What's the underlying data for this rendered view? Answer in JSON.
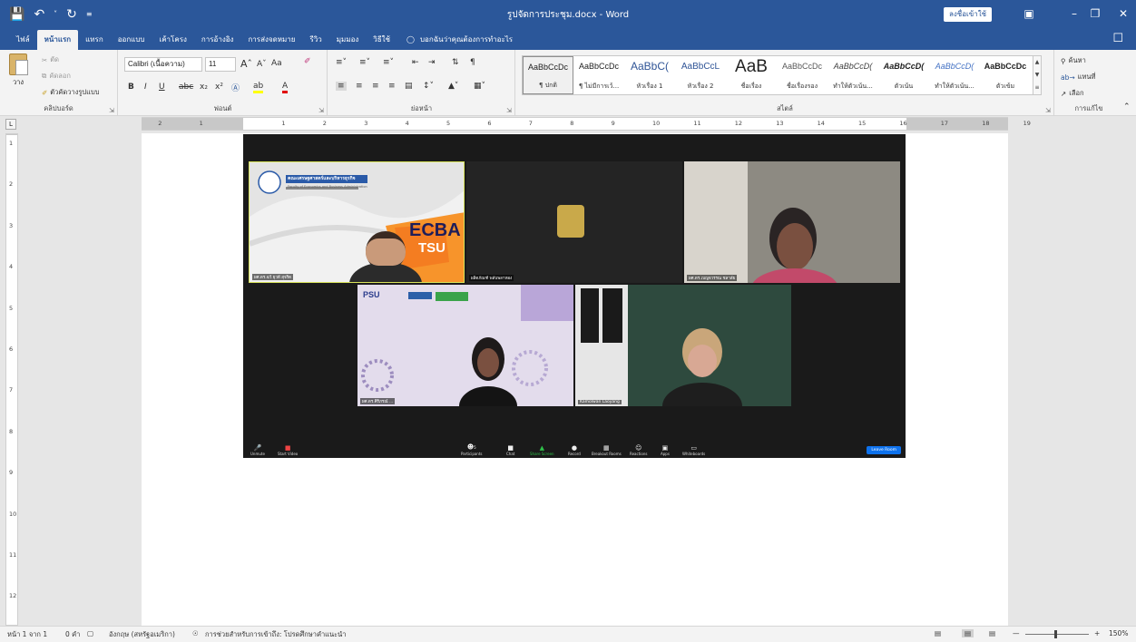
{
  "window": {
    "title": "รูปจัดการประชุม.docx - Word",
    "signin": "ลงชื่อเข้าใช้",
    "qat": {
      "save_icon": "save-icon",
      "undo_icon": "undo-icon",
      "redo_icon": "redo-icon"
    }
  },
  "tabs": [
    {
      "label": "ไฟล์"
    },
    {
      "label": "หน้าแรก"
    },
    {
      "label": "แทรก"
    },
    {
      "label": "ออกแบบ"
    },
    {
      "label": "เค้าโครง"
    },
    {
      "label": "การอ้างอิง"
    },
    {
      "label": "การส่งจดหมาย"
    },
    {
      "label": "รีวิว"
    },
    {
      "label": "มุมมอง"
    },
    {
      "label": "วิธีใช้"
    }
  ],
  "tellme": "บอกฉันว่าคุณต้องการทำอะไร",
  "ribbon": {
    "clipboard": {
      "group_label": "คลิปบอร์ด",
      "paste": "วาง",
      "cut": "ตัด",
      "copy": "คัดลอก",
      "format_painter": "ตัวคัดวางรูปแบบ"
    },
    "font": {
      "group_label": "ฟอนต์",
      "font_name": "Calibri (เนื้อความ)",
      "font_size": "11",
      "change_case": "Aa"
    },
    "paragraph": {
      "group_label": "ย่อหน้า"
    },
    "styles": {
      "group_label": "สไตล์",
      "items": [
        {
          "sample": "AaBbCcDc",
          "name": "¶ ปกติ"
        },
        {
          "sample": "AaBbCcDc",
          "name": "¶ ไม่มีการเว้..."
        },
        {
          "sample": "AaBbC(",
          "name": "หัวเรื่อง 1"
        },
        {
          "sample": "AaBbCcL",
          "name": "หัวเรื่อง 2"
        },
        {
          "sample": "AaB",
          "name": "ชื่อเรื่อง"
        },
        {
          "sample": "AaBbCcDc",
          "name": "ชื่อเรื่องรอง"
        },
        {
          "sample": "AaBbCcD(",
          "name": "ทำให้ตัวเน้น..."
        },
        {
          "sample": "AaBbCcD(",
          "name": "ตัวเน้น"
        },
        {
          "sample": "AaBbCcD(",
          "name": "ทำให้ตัวเน้น..."
        },
        {
          "sample": "AaBbCcDc",
          "name": "ตัวเข้ม"
        }
      ]
    },
    "editing": {
      "group_label": "การแก้ไข",
      "find": "ค้นหา",
      "replace": "แทนที่",
      "select": "เลือก"
    }
  },
  "ruler": {
    "corner": "L",
    "ticks": [
      "2",
      "1",
      "1",
      "2",
      "3",
      "4",
      "5",
      "6",
      "7",
      "8",
      "9",
      "10",
      "11",
      "12",
      "13",
      "14",
      "15",
      "16",
      "17",
      "18",
      "19"
    ],
    "vticks": [
      "1",
      "2",
      "3",
      "4",
      "5",
      "6",
      "7",
      "8",
      "9",
      "10",
      "11",
      "12",
      "13"
    ]
  },
  "zoom": {
    "participants": [
      {
        "name": "ผศ.ดร.ฉวี ยุวดี สุจริต"
      },
      {
        "name": "ผลิตภัณฑ์ พลับพลาทอง"
      },
      {
        "name": "ผศ.ดร.เบญจวรรณ ชลาสัย"
      },
      {
        "name": "ผศ.ดร.ศิริภรณ์ ..."
      },
      {
        "name": "Kamolwan Laoyang"
      }
    ],
    "slide_text": {
      "ecba_line1": "ECBA",
      "ecba_line2": "TSU",
      "faculty": "คณะเศรษฐศาสตร์และบริหารธุรกิจ",
      "faculty_en": "Faculty of Economics and Business Administration",
      "psu": "PSU"
    },
    "toolbar": [
      {
        "label": "Unmute",
        "icon": "mic-off-icon"
      },
      {
        "label": "Start Video",
        "icon": "video-off-icon"
      },
      {
        "label": "Participants",
        "icon": "participants-icon",
        "count": "5"
      },
      {
        "label": "Chat",
        "icon": "chat-icon"
      },
      {
        "label": "Share Screen",
        "icon": "share-screen-icon"
      },
      {
        "label": "Record",
        "icon": "record-icon"
      },
      {
        "label": "Breakout Rooms",
        "icon": "breakout-icon"
      },
      {
        "label": "Reactions",
        "icon": "reactions-icon"
      },
      {
        "label": "Apps",
        "icon": "apps-icon"
      },
      {
        "label": "Whiteboards",
        "icon": "whiteboard-icon"
      }
    ],
    "leave": "Leave Room"
  },
  "status": {
    "page": "หน้า 1 จาก 1",
    "words": "0 คำ",
    "language": "อังกฤษ (สหรัฐอเมริกา)",
    "accessibility": "การช่วยสำหรับการเข้าถึง: โปรดศึกษาคำแนะนำ",
    "zoom": "150%"
  }
}
